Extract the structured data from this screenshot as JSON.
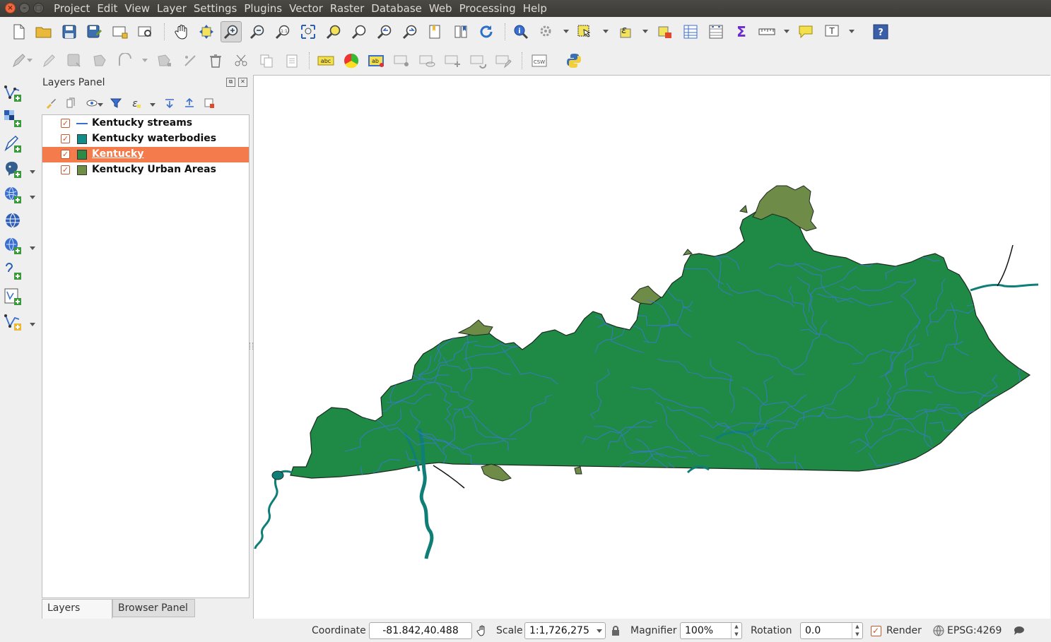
{
  "window": {
    "menus": [
      "Project",
      "Edit",
      "View",
      "Layer",
      "Settings",
      "Plugins",
      "Vector",
      "Raster",
      "Database",
      "Web",
      "Processing",
      "Help"
    ]
  },
  "toolbar": {
    "label_csw": "CSW",
    "label_abc": "abc",
    "label_ab": "ab",
    "label_help": "?",
    "label_t": "T"
  },
  "layers_panel": {
    "title": "Layers Panel",
    "layers": [
      {
        "name": "Kentucky streams",
        "checked": true,
        "symbol": "line",
        "color": "#3a6ecf",
        "selected": false
      },
      {
        "name": "Kentucky waterbodies",
        "checked": true,
        "symbol": "fill",
        "color": "#128c88",
        "selected": false
      },
      {
        "name": "Kentucky",
        "checked": true,
        "symbol": "fill",
        "color": "#2d8a45",
        "selected": true
      },
      {
        "name": "Kentucky Urban Areas",
        "checked": true,
        "symbol": "fill",
        "color": "#6f8f45",
        "selected": false
      }
    ],
    "tabs": [
      "Layers Panel",
      "Browser Panel"
    ]
  },
  "map": {
    "colors": {
      "state_fill": "#1f8a45",
      "state_edge": "#1c2a1f",
      "streams": "#3c78d8",
      "waterbodies": "#0f7e76",
      "urban": "#6e8b48"
    }
  },
  "status": {
    "coordinate_label": "Coordinate",
    "coordinate_value": "-81.842,40.488",
    "scale_label": "Scale",
    "scale_value": "1:1,726,275",
    "magnifier_label": "Magnifier",
    "magnifier_value": "100%",
    "rotation_label": "Rotation",
    "rotation_value": "0.0",
    "render_label": "Render",
    "render_checked": true,
    "crs": "EPSG:4269"
  }
}
